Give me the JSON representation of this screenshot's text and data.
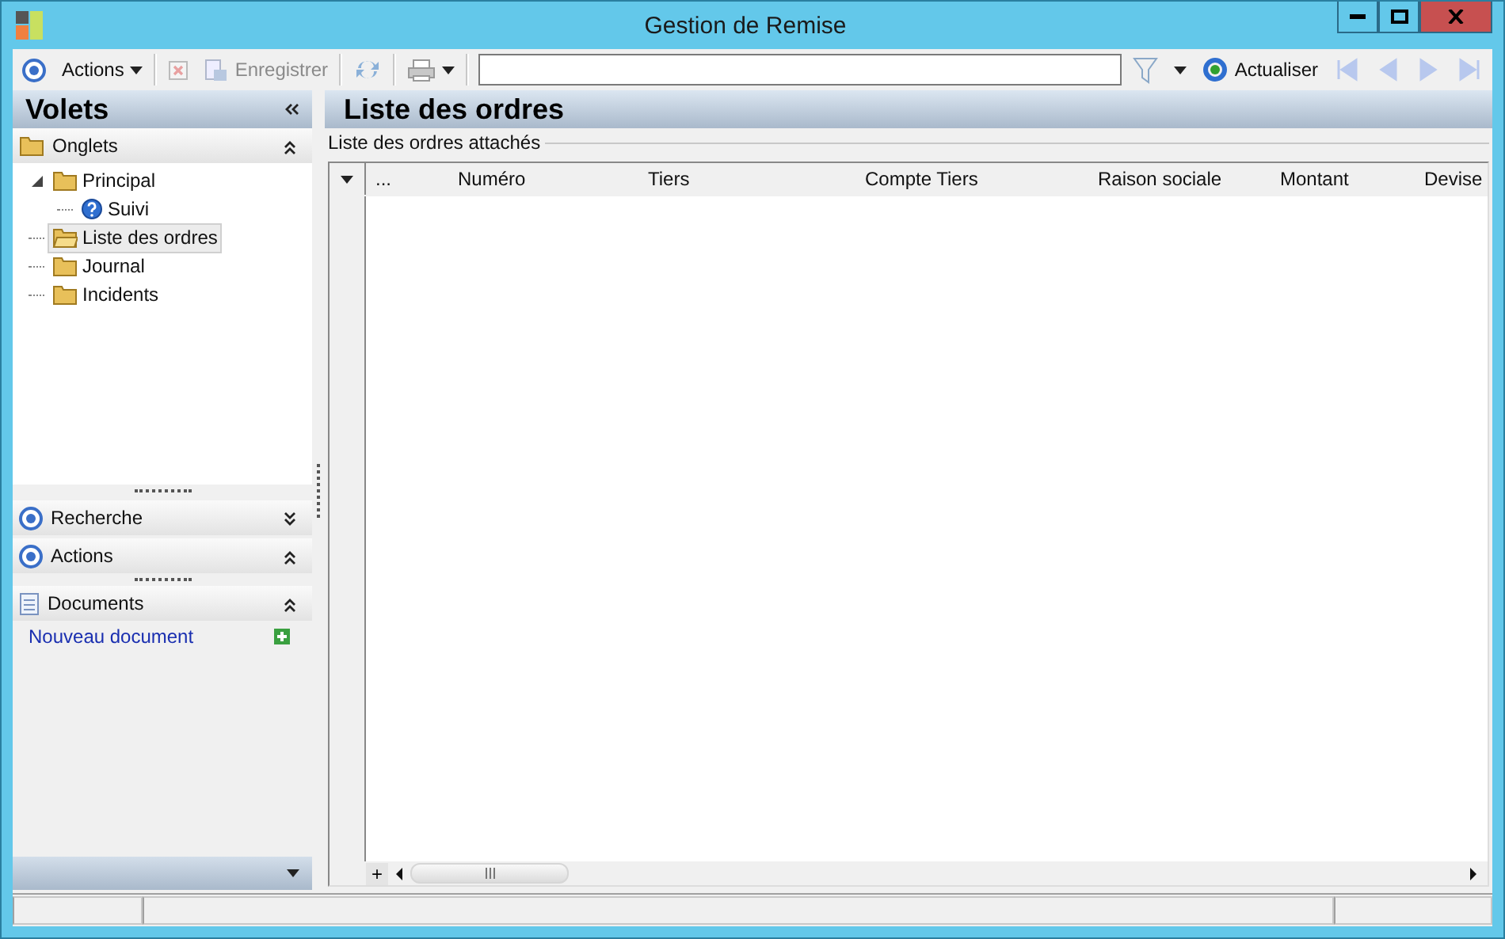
{
  "window": {
    "title": "Gestion de Remise"
  },
  "toolbar": {
    "actions_menu": {
      "label": "Actions"
    },
    "delete_button": {
      "disabled": true
    },
    "save_button": {
      "label": "Enregistrer",
      "disabled": true
    },
    "refresh_button": {
      "label": "Actualiser"
    },
    "navigation": {
      "disabled": true
    }
  },
  "side_panel": {
    "title": "Volets",
    "sections": [
      {
        "kind": "tree",
        "label": "Onglets",
        "expanded": true,
        "tree": [
          {
            "label": "Principal",
            "expanded": true,
            "selected": false,
            "children": [
              {
                "label": "Suivi",
                "selected": false
              }
            ]
          },
          {
            "label": "Liste des ordres",
            "selected": true
          },
          {
            "label": "Journal",
            "selected": false
          },
          {
            "label": "Incidents",
            "selected": false
          }
        ]
      },
      {
        "kind": "plain",
        "label": "Recherche",
        "expanded": false
      },
      {
        "kind": "plain",
        "label": "Actions",
        "expanded": true
      },
      {
        "kind": "links",
        "label": "Documents",
        "expanded": true,
        "links": [
          "Nouveau document"
        ]
      }
    ]
  },
  "main": {
    "title": "Liste des ordres",
    "group_label": "Liste des ordres attachés",
    "table": {
      "columns": [
        "...",
        "Numéro",
        "Tiers",
        "Compte Tiers",
        "Raison sociale",
        "Montant",
        "Devise"
      ]
    },
    "add_row_button": "+"
  }
}
